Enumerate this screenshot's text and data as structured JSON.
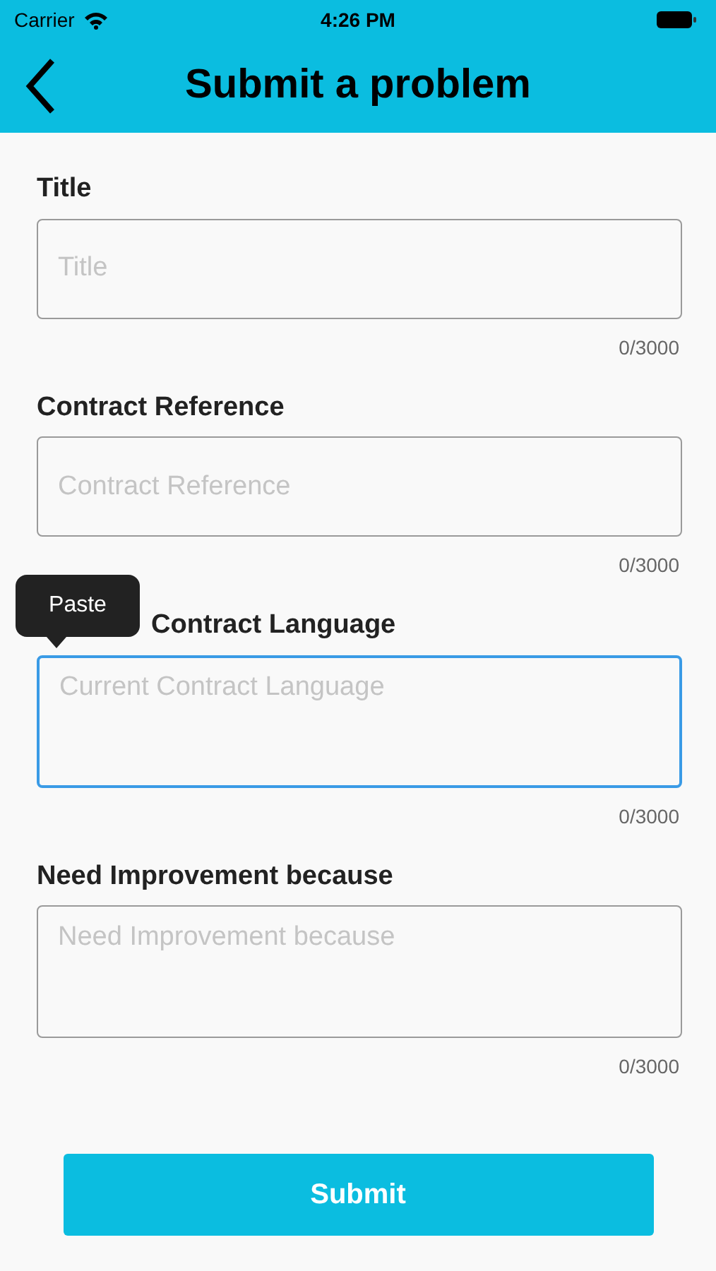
{
  "status_bar": {
    "carrier": "Carrier",
    "time": "4:26 PM"
  },
  "header": {
    "title": "Submit a problem"
  },
  "fields": [
    {
      "label": "Title",
      "placeholder": "Title",
      "kind": "single",
      "focused": false,
      "counter": "0/3000"
    },
    {
      "label": "Contract Reference",
      "placeholder": "Contract Reference",
      "kind": "single",
      "focused": false,
      "counter": "0/3000"
    },
    {
      "label": "Contract Language",
      "placeholder": "Current Contract Language",
      "kind": "multi",
      "focused": true,
      "counter": "0/3000",
      "tooltip": "Paste"
    },
    {
      "label": "Need Improvement because",
      "placeholder": "Need Improvement because",
      "kind": "multi",
      "focused": false,
      "counter": "0/3000"
    }
  ],
  "submit": {
    "label": "Submit"
  }
}
